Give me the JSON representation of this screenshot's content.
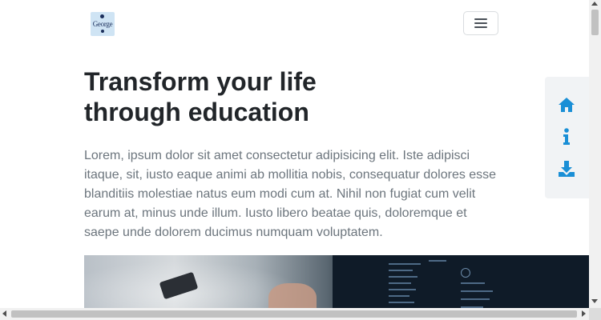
{
  "navbar": {
    "logo_text": "George",
    "menu_icon": "hamburger-icon"
  },
  "hero": {
    "title": "Transform your life through education",
    "paragraph": "Lorem, ipsum dolor sit amet consectetur adipisicing elit. Iste adipisci itaque, sit, iusto eaque animi ab mollitia nobis, consequatur dolores esse blanditiis molestiae natus eum modi cum at. Nihil non fugiat cum velit earum at, minus unde illum. Iusto libero beatae quis, doloremque et saepe unde dolorem ducimus numquam voluptatem.",
    "image_icon": "workspace-photo"
  },
  "side_toolbar": {
    "accent_color": "#1a8fd6",
    "items": [
      {
        "icon": "home-icon"
      },
      {
        "icon": "info-icon"
      },
      {
        "icon": "download-icon"
      }
    ]
  },
  "colors": {
    "title": "#212529",
    "body_text": "#6c757d",
    "toolbar_bg": "#f1f3f5"
  }
}
